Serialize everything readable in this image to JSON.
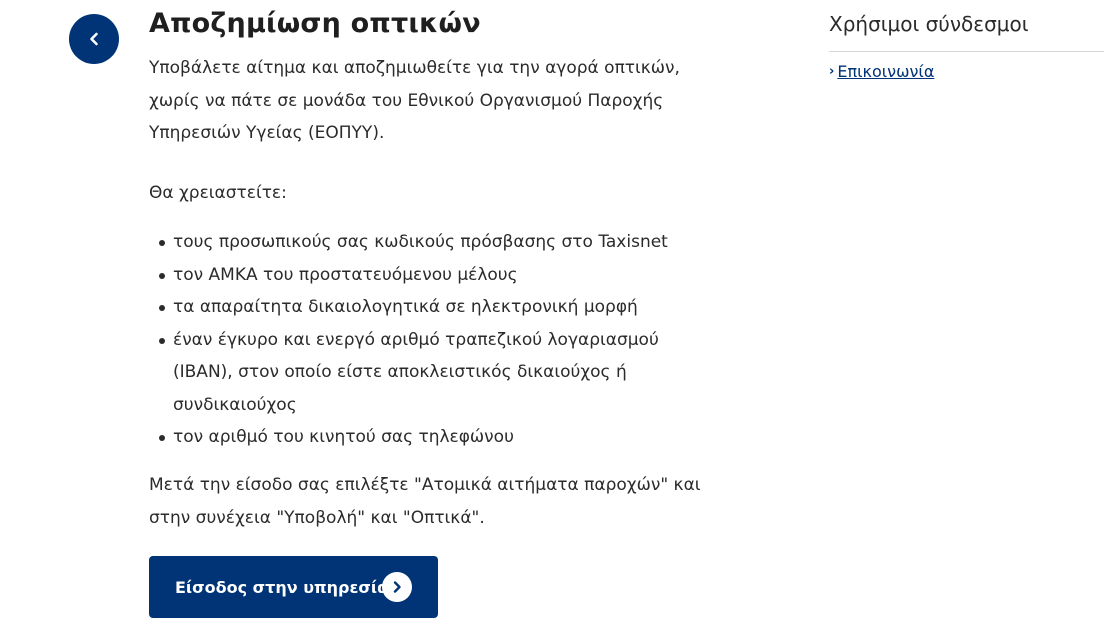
{
  "header": {
    "back_icon": "chevron-left-icon",
    "title": "Αποζημίωση οπτικών"
  },
  "main": {
    "intro": "Υποβάλετε αίτημα και αποζημιωθείτε για την αγορά οπτικών, χωρίς να πάτε σε μονάδα του Εθνικού Οργανισμού Παροχής Υπηρεσιών Υγείας (ΕΟΠΥΥ).",
    "need_label": "Θα χρειαστείτε:",
    "requirements": [
      "τους προσωπικούς σας κωδικούς πρόσβασης στο Taxisnet",
      "τον ΑΜΚΑ του προστατευόμενου μέλους",
      "τα απαραίτητα δικαιολογητικά σε ηλεκτρονική μορφή",
      "έναν έγκυρο και ενεργό αριθμό τραπεζικού λογαριασμού (IBAN), στον οποίο είστε αποκλειστικός δικαιούχος ή συνδικαιούχος",
      "τον αριθμό του κινητού σας τηλεφώνου"
    ],
    "outro": "Μετά την είσοδο σας επιλέξτε \"Ατομικά αιτήματα παροχών\" και στην συνέχεια \"Υποβολή\" και \"Οπτικά\".",
    "cta_label": "Είσοδος στην υπηρεσία",
    "cta_icon": "chevron-right-icon"
  },
  "sidebar": {
    "title": "Χρήσιμοι σύνδεσμοι",
    "links": [
      {
        "label": "Επικοινωνία",
        "icon": "chevron-right-icon"
      }
    ]
  },
  "colors": {
    "primary": "#003476",
    "text": "#2b2b2b",
    "divider": "#d8d8d8"
  }
}
